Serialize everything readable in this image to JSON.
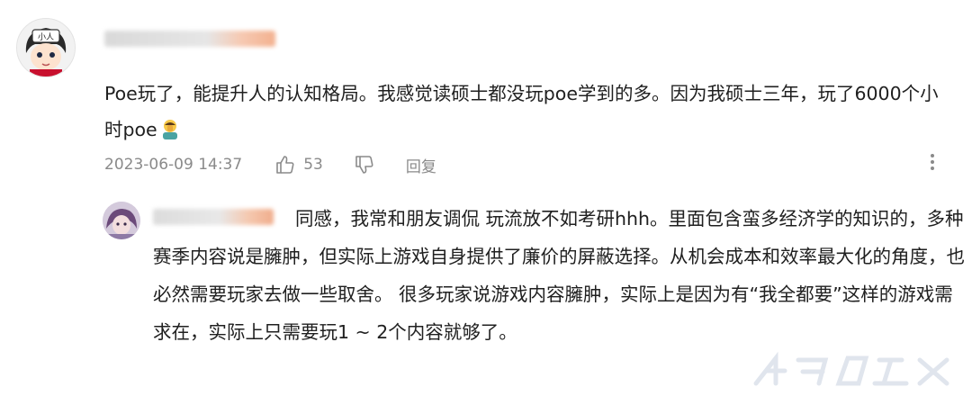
{
  "comment": {
    "text": "Poe玩了，能提升人的认知格局。我感觉读硕士都没玩poe学到的多。因为我硕士三年，玩了6000个小时poe",
    "emoji": "person-facepalming-emoji",
    "timestamp": "2023-06-09 14:37",
    "like_count": "53",
    "reply_label": "回复",
    "avatar_label": "小人"
  },
  "reply": {
    "text": "同感，我常和朋友调侃 玩流放不如考研hhh。里面包含蛮多经济学的知识的，多种赛季内容说是臃肿，但实际上游戏自身提供了廉价的屏蔽选择。从机会成本和效率最大化的角度，也必然需要玩家去做一些取舍。 很多玩家说游戏内容臃肿，实际上是因为有“我全都要”这样的游戏需求在，实际上只需要玩1 ~ 2个内容就够了。"
  },
  "icons": [
    "thumbs-up-icon",
    "thumbs-down-icon",
    "reply-icon",
    "more-vertical-icon"
  ],
  "colors": {
    "text": "#202020",
    "meta": "#8a8a8a",
    "background": "#ffffff"
  }
}
